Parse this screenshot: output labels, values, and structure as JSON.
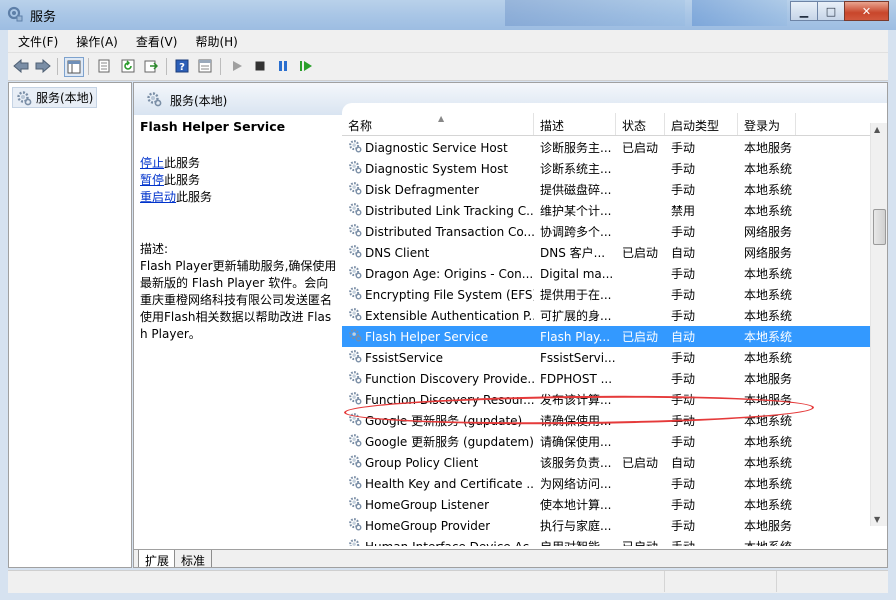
{
  "window": {
    "title": "服务"
  },
  "menu": {
    "items": [
      "文件(F)",
      "操作(A)",
      "查看(V)",
      "帮助(H)"
    ]
  },
  "toolbar": {
    "icons": [
      "back-icon",
      "forward-icon",
      "show-hide-tree-icon",
      "properties-icon",
      "refresh-icon",
      "export-icon",
      "help-icon",
      "console-view-icon",
      "start-icon",
      "stop-icon",
      "pause-icon",
      "restart-icon"
    ]
  },
  "tree": {
    "root_label": "服务(本地)"
  },
  "main": {
    "header": "服务(本地)"
  },
  "details": {
    "service_name": "Flash Helper Service",
    "actions": [
      {
        "link": "停止",
        "suffix": "此服务"
      },
      {
        "link": "暂停",
        "suffix": "此服务"
      },
      {
        "link": "重启动",
        "suffix": "此服务"
      }
    ],
    "desc_label": "描述:",
    "desc_text": "Flash Player更新辅助服务,确保使用最新版的 Flash Player 软件。会向重庆重橙网络科技有限公司发送匿名使用Flash相关数据以帮助改进 Flash Player。"
  },
  "columns": [
    "名称",
    "描述",
    "状态",
    "启动类型",
    "登录为"
  ],
  "services": [
    {
      "name": "Diagnostic Service Host",
      "desc": "诊断服务主...",
      "status": "已启动",
      "startup": "手动",
      "logon": "本地服务"
    },
    {
      "name": "Diagnostic System Host",
      "desc": "诊断系统主...",
      "status": "",
      "startup": "手动",
      "logon": "本地系统"
    },
    {
      "name": "Disk Defragmenter",
      "desc": "提供磁盘碎...",
      "status": "",
      "startup": "手动",
      "logon": "本地系统"
    },
    {
      "name": "Distributed Link Tracking C...",
      "desc": "维护某个计...",
      "status": "",
      "startup": "禁用",
      "logon": "本地系统"
    },
    {
      "name": "Distributed Transaction Co...",
      "desc": "协调跨多个...",
      "status": "",
      "startup": "手动",
      "logon": "网络服务"
    },
    {
      "name": "DNS Client",
      "desc": "DNS 客户...",
      "status": "已启动",
      "startup": "自动",
      "logon": "网络服务"
    },
    {
      "name": "Dragon Age: Origins - Con...",
      "desc": "Digital ma...",
      "status": "",
      "startup": "手动",
      "logon": "本地系统"
    },
    {
      "name": "Encrypting File System (EFS)",
      "desc": "提供用于在...",
      "status": "",
      "startup": "手动",
      "logon": "本地系统"
    },
    {
      "name": "Extensible Authentication P...",
      "desc": "可扩展的身...",
      "status": "",
      "startup": "手动",
      "logon": "本地系统"
    },
    {
      "name": "Flash Helper Service",
      "desc": "Flash Play...",
      "status": "已启动",
      "startup": "自动",
      "logon": "本地系统",
      "selected": true
    },
    {
      "name": "FssistService",
      "desc": "FssistServi...",
      "status": "",
      "startup": "手动",
      "logon": "本地系统"
    },
    {
      "name": "Function Discovery Provide...",
      "desc": "FDPHOST ...",
      "status": "",
      "startup": "手动",
      "logon": "本地服务"
    },
    {
      "name": "Function Discovery Resour...",
      "desc": "发布该计算...",
      "status": "",
      "startup": "手动",
      "logon": "本地服务"
    },
    {
      "name": "Google 更新服务 (gupdate)",
      "desc": "请确保使用...",
      "status": "",
      "startup": "手动",
      "logon": "本地系统"
    },
    {
      "name": "Google 更新服务 (gupdatem)",
      "desc": "请确保使用...",
      "status": "",
      "startup": "手动",
      "logon": "本地系统"
    },
    {
      "name": "Group Policy Client",
      "desc": "该服务负责...",
      "status": "已启动",
      "startup": "自动",
      "logon": "本地系统"
    },
    {
      "name": "Health Key and Certificate ...",
      "desc": "为网络访问...",
      "status": "",
      "startup": "手动",
      "logon": "本地系统"
    },
    {
      "name": "HomeGroup Listener",
      "desc": "使本地计算...",
      "status": "",
      "startup": "手动",
      "logon": "本地系统"
    },
    {
      "name": "HomeGroup Provider",
      "desc": "执行与家庭...",
      "status": "",
      "startup": "手动",
      "logon": "本地服务"
    },
    {
      "name": "Human Interface Device Ac...",
      "desc": "启用对智能...",
      "status": "已启动",
      "startup": "手动",
      "logon": "本地系统"
    }
  ],
  "tabs": [
    "扩展",
    "标准"
  ],
  "colors": {
    "selection": "#3399ff",
    "highlight_ring": "#e53a3a",
    "link": "#0033cc"
  }
}
